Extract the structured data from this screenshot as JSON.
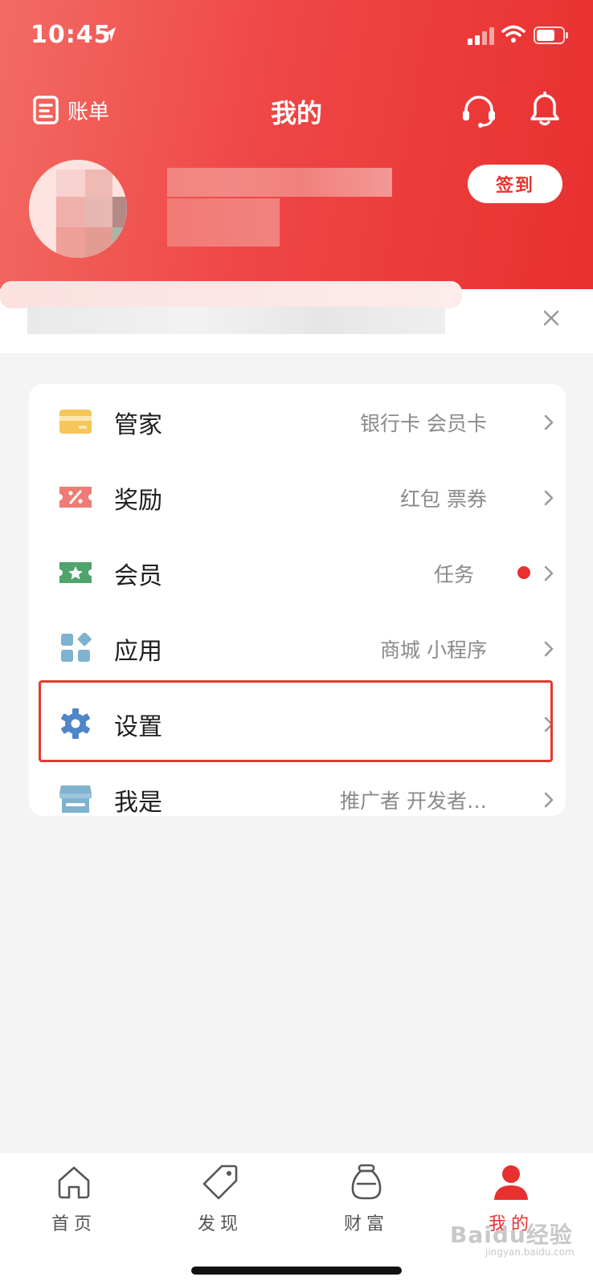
{
  "status_bar": {
    "time": "10:45"
  },
  "nav": {
    "bill_label": "账单",
    "title": "我的"
  },
  "profile": {
    "checkin_label": "签到"
  },
  "menu": [
    {
      "label": "管家",
      "sub": "银行卡 会员卡",
      "icon": "card-icon"
    },
    {
      "label": "奖励",
      "sub": "红包 票券",
      "icon": "coupon-icon"
    },
    {
      "label": "会员",
      "sub": "任务",
      "icon": "vip-ticket-icon",
      "badge": true
    },
    {
      "label": "应用",
      "sub": "商城 小程序",
      "icon": "apps-grid-icon"
    },
    {
      "label": "设置",
      "sub": "",
      "icon": "gear-icon",
      "highlighted": true
    },
    {
      "label": "我是",
      "sub": "推广者 开发者…",
      "icon": "store-icon"
    }
  ],
  "tabs": [
    {
      "label": "首页",
      "icon": "home-icon"
    },
    {
      "label": "发现",
      "icon": "tag-icon"
    },
    {
      "label": "财富",
      "icon": "money-bag-icon"
    },
    {
      "label": "我的",
      "icon": "user-icon",
      "active": true
    }
  ],
  "watermark": {
    "text": "Baidu经验",
    "sub": "jingyan.baidu.com"
  },
  "colors": {
    "accent": "#e8302f",
    "highlight_border": "#e43a2f"
  }
}
